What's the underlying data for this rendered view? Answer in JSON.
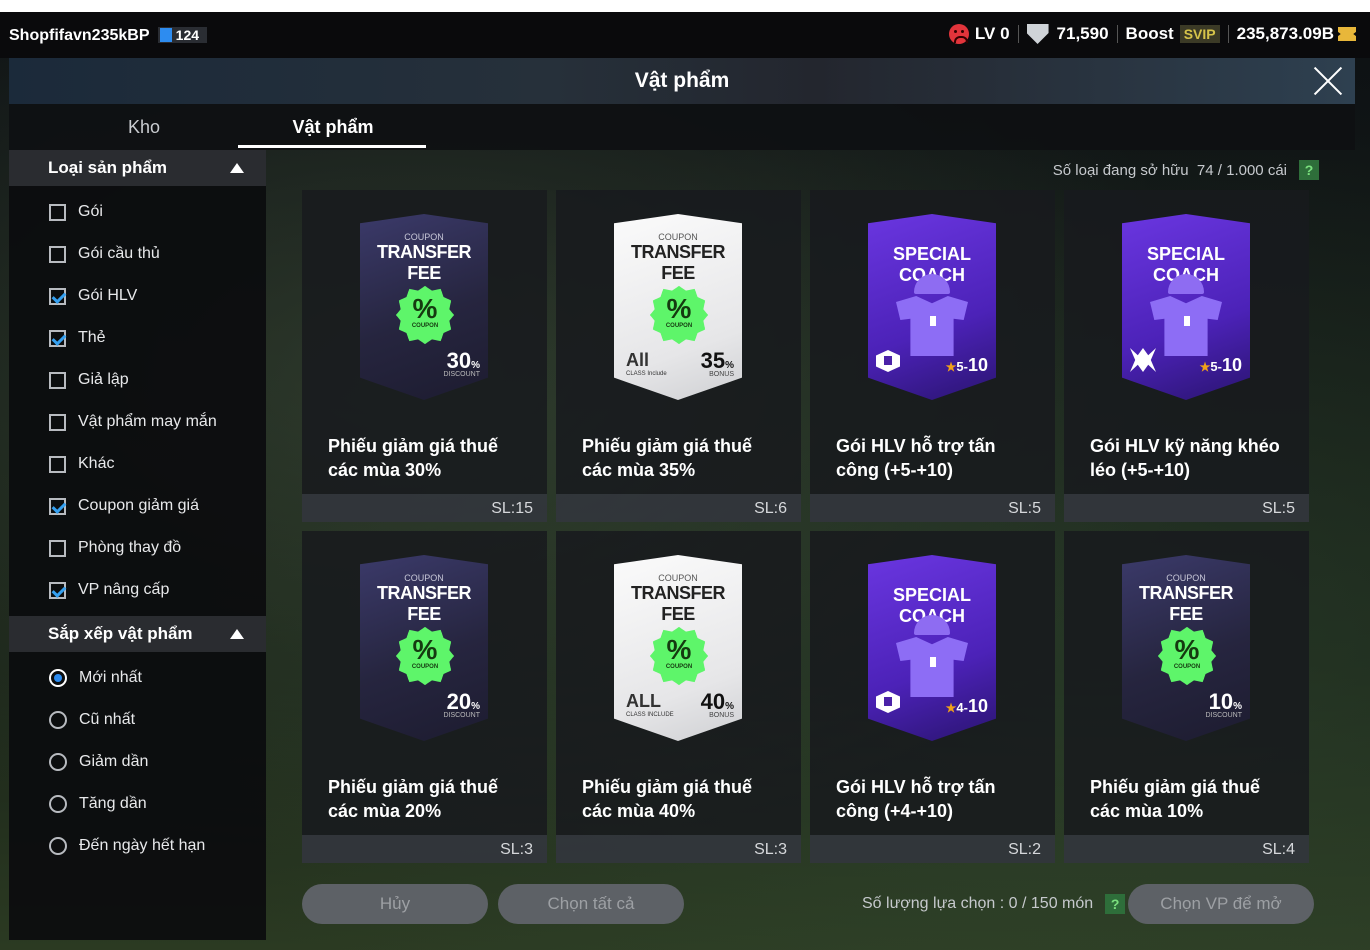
{
  "topbar": {
    "username": "Shopfifavn235kBP",
    "user_level": "124",
    "lv_label": "LV 0",
    "ovr": "71,590",
    "boost_label": "Boost",
    "svip_label": "SVIP",
    "balance": "235,873.09B"
  },
  "header": {
    "title": "Vật phẩm"
  },
  "tabs": [
    "Kho",
    "Vật phẩm"
  ],
  "sidebar": {
    "product_type": {
      "title": "Loại sản phẩm",
      "options": [
        {
          "label": "Gói",
          "checked": false
        },
        {
          "label": "Gói cầu thủ",
          "checked": false
        },
        {
          "label": "Gói HLV",
          "checked": true
        },
        {
          "label": "Thẻ",
          "checked": true
        },
        {
          "label": "Giả lập",
          "checked": false
        },
        {
          "label": "Vật phẩm may mắn",
          "checked": false
        },
        {
          "label": "Khác",
          "checked": false
        },
        {
          "label": "Coupon giảm giá",
          "checked": true
        },
        {
          "label": "Phòng thay đồ",
          "checked": false
        },
        {
          "label": "VP nâng cấp",
          "checked": true
        }
      ]
    },
    "sort": {
      "title": "Sắp xếp vật phẩm",
      "options": [
        {
          "label": "Mới nhất",
          "selected": true
        },
        {
          "label": "Cũ nhất",
          "selected": false
        },
        {
          "label": "Giảm dần",
          "selected": false
        },
        {
          "label": "Tăng dần",
          "selected": false
        },
        {
          "label": "Đến ngày hết hạn",
          "selected": false
        }
      ]
    }
  },
  "main": {
    "owned_label": "Số loại đang sở hữu",
    "owned_value": "74 / 1.000 cái",
    "help": "?",
    "items": [
      {
        "name": "Phiếu giảm giá thuế các mùa 30%",
        "qty": "SL:15",
        "art": {
          "kind": "coupon-dark",
          "top": "COUPON",
          "title": "TRANSFER FEE",
          "badge": "%",
          "badge_sub": "COUPON",
          "num": "30",
          "unit": "%",
          "sub": "DISCOUNT"
        }
      },
      {
        "name": "Phiếu giảm giá thuế các mùa 35%",
        "qty": "SL:6",
        "art": {
          "kind": "coupon-white",
          "top": "COUPON",
          "title": "TRANSFER FEE",
          "badge": "%",
          "badge_sub": "COUPON",
          "num": "35",
          "unit": "%",
          "sub": "BONUS",
          "all": "All",
          "all_sub": "CLASS Include"
        }
      },
      {
        "name": "Gói HLV hỗ trợ tấn công (+5-+10)",
        "qty": "SL:5",
        "art": {
          "kind": "coach",
          "title": "SPECIAL COACH",
          "star": "★",
          "lo": "5-",
          "hi": "10",
          "icon": "lock-icon"
        }
      },
      {
        "name": "Gói HLV kỹ năng khéo léo (+5-+10)",
        "qty": "SL:5",
        "art": {
          "kind": "coach",
          "title": "SPECIAL COACH",
          "star": "★",
          "lo": "5-",
          "hi": "10",
          "icon": "skill-icon"
        }
      },
      {
        "name": "Phiếu giảm giá thuế các mùa 20%",
        "qty": "SL:3",
        "art": {
          "kind": "coupon-dark",
          "top": "COUPON",
          "title": "TRANSFER FEE",
          "badge": "%",
          "badge_sub": "COUPON",
          "num": "20",
          "unit": "%",
          "sub": "DISCOUNT"
        }
      },
      {
        "name": "Phiếu giảm giá thuế các mùa 40%",
        "qty": "SL:3",
        "art": {
          "kind": "coupon-white",
          "top": "COUPON",
          "title": "TRANSFER FEE",
          "badge": "%",
          "badge_sub": "COUPON",
          "num": "40",
          "unit": "%",
          "sub": "BONUS",
          "all": "ALL",
          "all_sub": "CLASS INCLUDE"
        }
      },
      {
        "name": "Gói HLV hỗ trợ tấn công (+4-+10)",
        "qty": "SL:2",
        "art": {
          "kind": "coach",
          "title": "SPECIAL COACH",
          "star": "★",
          "lo": "4-",
          "hi": "10",
          "icon": "lock-icon"
        }
      },
      {
        "name": "Phiếu giảm giá thuế các mùa 10%",
        "qty": "SL:4",
        "art": {
          "kind": "coupon-dark",
          "top": "COUPON",
          "title": "TRANSFER FEE",
          "badge": "%",
          "badge_sub": "COUPON",
          "num": "10",
          "unit": "%",
          "sub": "DISCOUNT"
        }
      }
    ]
  },
  "footer": {
    "cancel": "Hủy",
    "select_all": "Chọn tất cả",
    "selected_count": "Số lượng lựa chọn : 0 / 150 món",
    "help": "?",
    "open_selected": "Chọn VP để mở"
  }
}
